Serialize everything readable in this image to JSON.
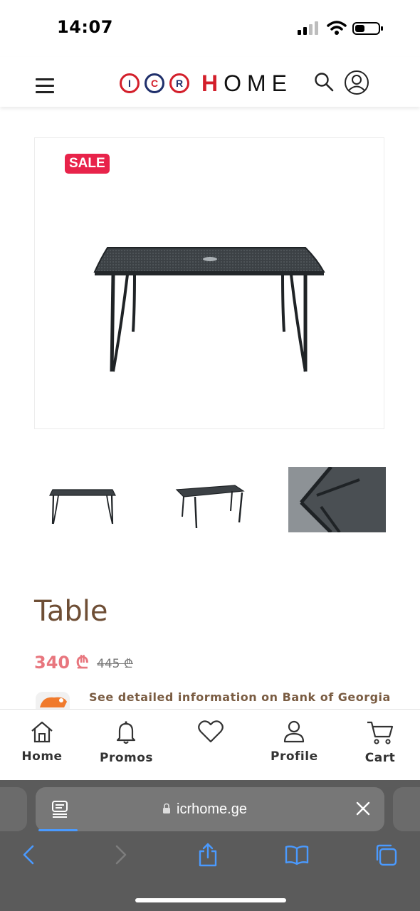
{
  "status_bar": {
    "time": "14:07"
  },
  "header": {
    "logo_letters": [
      "I",
      "C",
      "R"
    ],
    "logo_word_first": "H",
    "logo_word_rest": "OME"
  },
  "product": {
    "badge": "SALE",
    "title": "Table",
    "price": "340 ₾",
    "old_price": "445 ₾",
    "bank_info": "See detailed information on Bank of Georgia",
    "thumbnails": 3
  },
  "bottom_nav": {
    "items": [
      {
        "label": "Home",
        "icon": "home-icon"
      },
      {
        "label": "Promos",
        "icon": "bell-icon"
      },
      {
        "label": "",
        "icon": "heart-icon"
      },
      {
        "label": "Profile",
        "icon": "person-icon"
      },
      {
        "label": "Cart",
        "icon": "cart-icon"
      }
    ]
  },
  "browser": {
    "url": "icrhome.ge"
  },
  "colors": {
    "brand_red": "#d31f2b",
    "brand_navy": "#1f2f6b",
    "sale_badge": "#e8234a",
    "price": "#e8767e",
    "title": "#6e4e35",
    "safari_accent": "#4a9aff"
  }
}
